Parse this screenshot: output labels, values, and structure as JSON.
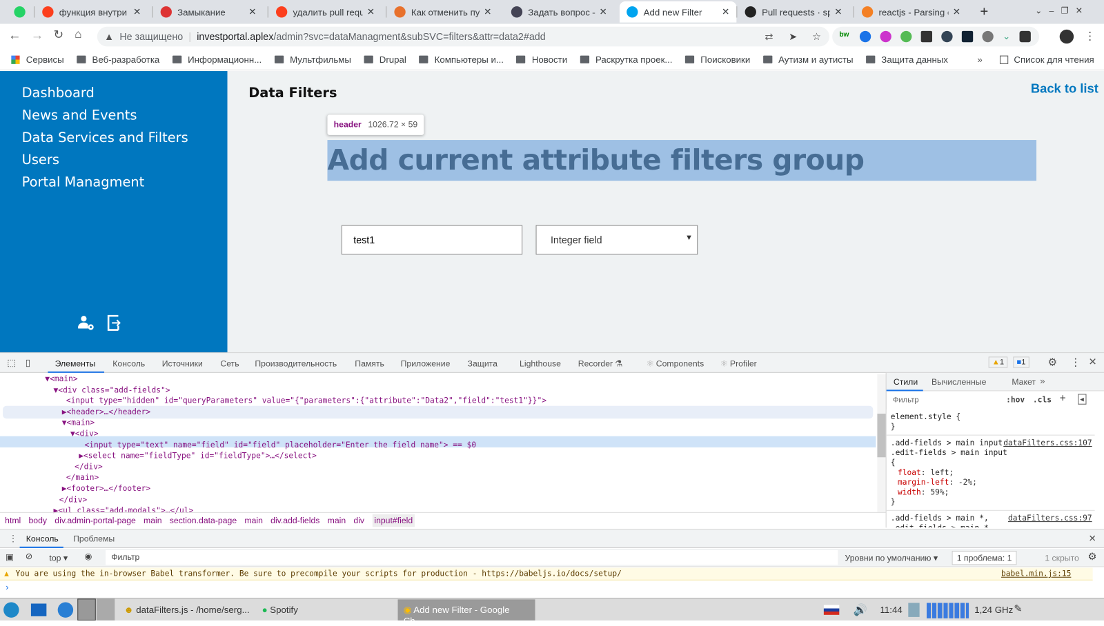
{
  "browser": {
    "tabs": [
      {
        "title": "",
        "icon": "whatsapp-icon",
        "color": "#25d366"
      },
      {
        "title": "функция внутри ф",
        "icon": "yandex-icon",
        "color": "#fc3f1d"
      },
      {
        "title": "Замыкание",
        "icon": "tower-icon",
        "color": "#d33"
      },
      {
        "title": "удалить pull requ",
        "icon": "yandex-icon",
        "color": "#fc3f1d"
      },
      {
        "title": "Как отменить пул",
        "icon": "compass-icon",
        "color": "#e8712c"
      },
      {
        "title": "Задать вопрос —",
        "icon": "habr-icon",
        "color": "#445"
      },
      {
        "title": "Add new Filter",
        "icon": "microsoft-icon",
        "color": "#00a4ef"
      },
      {
        "title": "Pull requests · spri",
        "icon": "github-icon",
        "color": "#222"
      },
      {
        "title": "reactjs - Parsing er",
        "icon": "stackoverflow-icon",
        "color": "#f48024"
      }
    ],
    "security": "Не защищено",
    "url_host": "investportal.aplex",
    "url_path": "/admin?svc=dataManagment&subSVC=filters&attr=data2#add",
    "bookmarks": [
      "Сервисы",
      "Веб-разработка",
      "Информационн...",
      "Мультфильмы",
      "Drupal",
      "Компьютеры и...",
      "Новости",
      "Раскрутка проек...",
      "Поисковики",
      "Аутизм и аутисты",
      "Защита данных"
    ],
    "reading_list": "Список для чтения"
  },
  "sidebar": {
    "items": [
      "Dashboard",
      "News and Events",
      "Data Services and Filters",
      "Users",
      "Portal Managment"
    ]
  },
  "main": {
    "title": "Data Filters",
    "back": "Back to list",
    "tooltip_tag": "header",
    "tooltip_size": "1026.72 × 59",
    "heading": "Add current attribute filters group",
    "field_value": "test1",
    "field_placeholder": "Enter the field name",
    "type_selected": "Integer field"
  },
  "devtools": {
    "tabs": [
      "Элементы",
      "Консоль",
      "Источники",
      "Сеть",
      "Производительность",
      "Память",
      "Приложение",
      "Защита",
      "Lighthouse",
      "Recorder",
      "Components",
      "Profiler"
    ],
    "warn_count": "1",
    "msg_count": "1",
    "dom": [
      "▼<main>",
      "▼<div class=\"add-fields\">",
      "<input type=\"hidden\" id=\"queryParameters\" value=\"{\"parameters\":{\"attribute\":\"Data2\",\"field\":\"test1\"}}\">",
      "▶<header>…</header>",
      "▼<main>",
      "▼<div>",
      "<input type=\"text\" name=\"field\" id=\"field\" placeholder=\"Enter the field name\"> == $0",
      "▶<select name=\"fieldType\" id=\"fieldType\">…</select>",
      "</div>",
      "</main>",
      "▶<footer>…</footer>",
      "</div>",
      "▶<ul class=\"add-modals\">…</ul>"
    ],
    "breadcrumbs": [
      "html",
      "body",
      "div.admin-portal-page",
      "main",
      "section.data-page",
      "main",
      "div.add-fields",
      "main",
      "div",
      "input#field"
    ],
    "styles_tabs": [
      "Стили",
      "Вычисленные",
      "Макет"
    ],
    "styles_filter": "Фильтр",
    "hov": ":hov",
    "cls": ".cls",
    "rules": [
      {
        "selector": "element.style {",
        "source": "",
        "props": []
      },
      {
        "selector": ".add-fields > main input, .edit-fields > main input {",
        "source": "dataFilters.css:107",
        "props": [
          [
            "float",
            "left"
          ],
          [
            "margin-left",
            "-2%"
          ],
          [
            "width",
            "59%"
          ]
        ]
      },
      {
        "selector": ".add-fields > main *, .edit-fields > main *",
        "source": "dataFilters.css:97",
        "props": []
      }
    ],
    "console_tabs": [
      "Консоль",
      "Проблемы"
    ],
    "context": "top",
    "console_filter": "Фильтр",
    "levels": "Уровни по умолчанию",
    "issues": "1 проблема: 1",
    "hidden": "1 скрыто",
    "warning": "You are using the in-browser Babel transformer. Be sure to precompile your scripts for production - https://babeljs.io/docs/setup/",
    "warning_source": "babel.min.js:15"
  },
  "taskbar": {
    "apps": [
      "dataFilters.js - /home/serg...",
      "Spotify",
      "Add new Filter - Google Ch..."
    ],
    "time": "11:44",
    "cpu": "1,24 GHz"
  }
}
